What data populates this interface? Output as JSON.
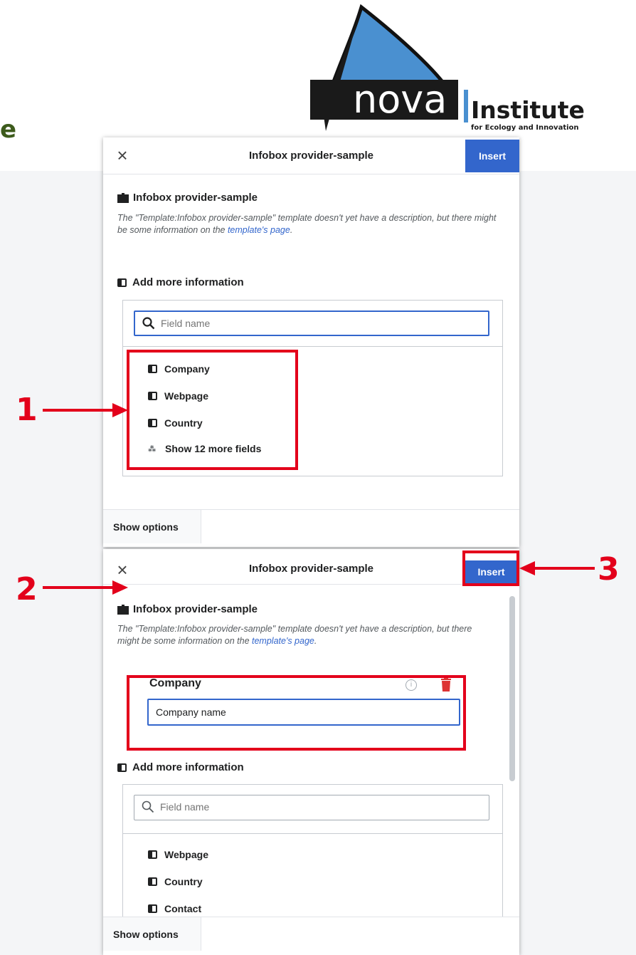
{
  "page": {
    "title_fragment": "e"
  },
  "logo": {
    "brand_word": "nova",
    "institute_word": "Institute",
    "tagline": "for Ecology and Innovation"
  },
  "dialog1": {
    "title": "Infobox provider-sample",
    "insert_label": "Insert",
    "template_heading": "Infobox provider-sample",
    "description_before": "The \"Template:Infobox provider-sample\" template doesn't yet have a description, but there might be some information on the ",
    "description_link": "template's page",
    "description_after": ".",
    "add_more_label": "Add more information",
    "search_placeholder": "Field name",
    "fields": [
      "Company",
      "Webpage",
      "Country"
    ],
    "show_more_label": "Show 12 more fields",
    "show_options_label": "Show options"
  },
  "dialog2": {
    "title": "Infobox provider-sample",
    "insert_label": "Insert",
    "template_heading": "Infobox provider-sample",
    "description_before": "The \"Template:Infobox provider-sample\" template doesn't yet have a description, but there might be some information on the ",
    "description_link": "template's page",
    "description_after": ".",
    "param_label": "Company",
    "param_value": "Company name",
    "add_more_label": "Add more information",
    "search_placeholder": "Field name",
    "fields": [
      "Webpage",
      "Country",
      "Contact"
    ],
    "show_options_label": "Show options"
  },
  "annotations": {
    "step1": "1",
    "step2": "2",
    "step3": "3"
  },
  "colors": {
    "accent_blue": "#3366cc",
    "annotation_red": "#e3001b",
    "heading_green": "#3d5b1c",
    "logo_blue": "#4a90d0"
  },
  "icons": {
    "close": "close-icon",
    "search": "search-icon",
    "template": "puzzle-icon",
    "parameter": "parameter-icon",
    "info": "info-icon",
    "delete": "trash-icon"
  }
}
